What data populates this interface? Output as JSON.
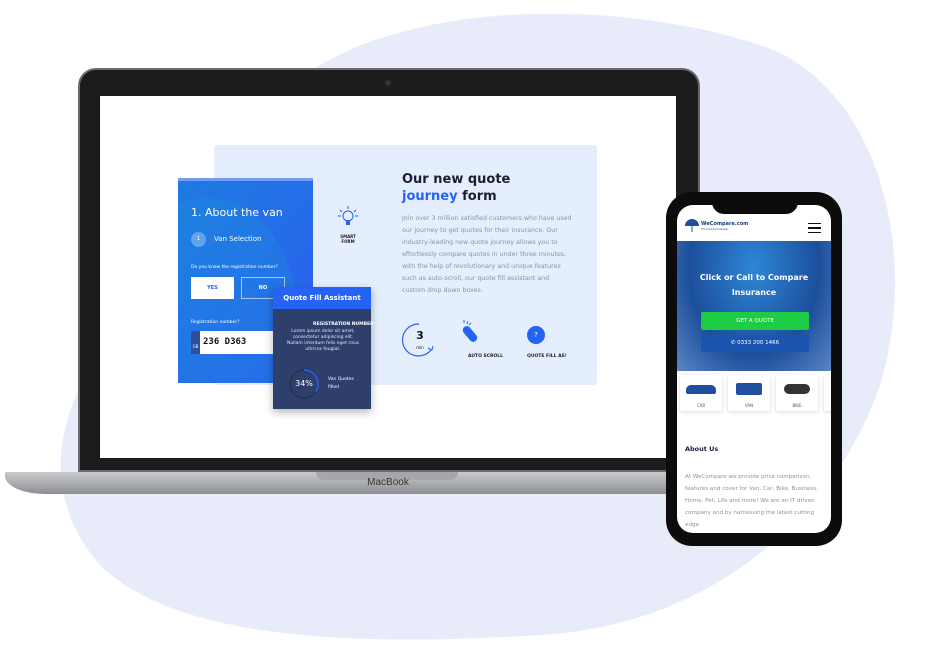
{
  "laptop": {
    "brand": "MacBook",
    "form_card": {
      "title": "1. About the van",
      "step_number": "1",
      "step_label": "Van Selection",
      "question": "Do you know the registration number?",
      "yes_label": "YES",
      "no_label": "NO",
      "reg_label": "Registration number?",
      "reg_country": "GB",
      "reg_value": "236 D363"
    },
    "assistant": {
      "title": "Quote Fill Assistant",
      "subtitle": "REGISTRATION NUMBER",
      "body": "Lorem ipsum dolor sit amet, consectetur adipiscing elit. Nullam interdum felis eget risus ultrices feugiat.",
      "percent": "34%",
      "progress": 34,
      "progress_label": "Van Quotes filled"
    },
    "smart_form_label": "SMART FORM",
    "heading_line1": "Our new quote",
    "heading_accent": "journey",
    "heading_rest": " form",
    "description": "Join over 3 million satisfied customers who have used our journey to get quotes for their insurance. Our industry-leading new quote journey allows you to effortlessly compare quotes in under three minutes, with the help of revolutionary and unique features such as auto-scroll, our quote fill assistant and custom drop down boxes.",
    "features": [
      {
        "value": "3",
        "unit": "min"
      },
      {
        "label": "AUTO SCROLL"
      },
      {
        "icon": "?",
        "label": "QUOTE FILL AS!"
      }
    ]
  },
  "phone": {
    "logo": "WeCompare.com",
    "logo_tagline": "The Insurance People",
    "hero_title": "Click or Call to Compare Insurance",
    "quote_button": "GET A QUOTE",
    "phone_number": "0333 200 1466",
    "vehicles": [
      "CAR",
      "VAN",
      "BIKE"
    ],
    "about_title": "About Us",
    "about_text": "At WeCompare we provide price comparison, features and cover for Van, Car, Bike, Business, Home, Pet, Life and more! We are an IT driven company and by harnessing the latest cutting edge"
  },
  "colors": {
    "accent": "#2563f5",
    "green": "#1fcc45",
    "dark_card": "#2f3f6b",
    "blob": "#e8ecfa"
  }
}
